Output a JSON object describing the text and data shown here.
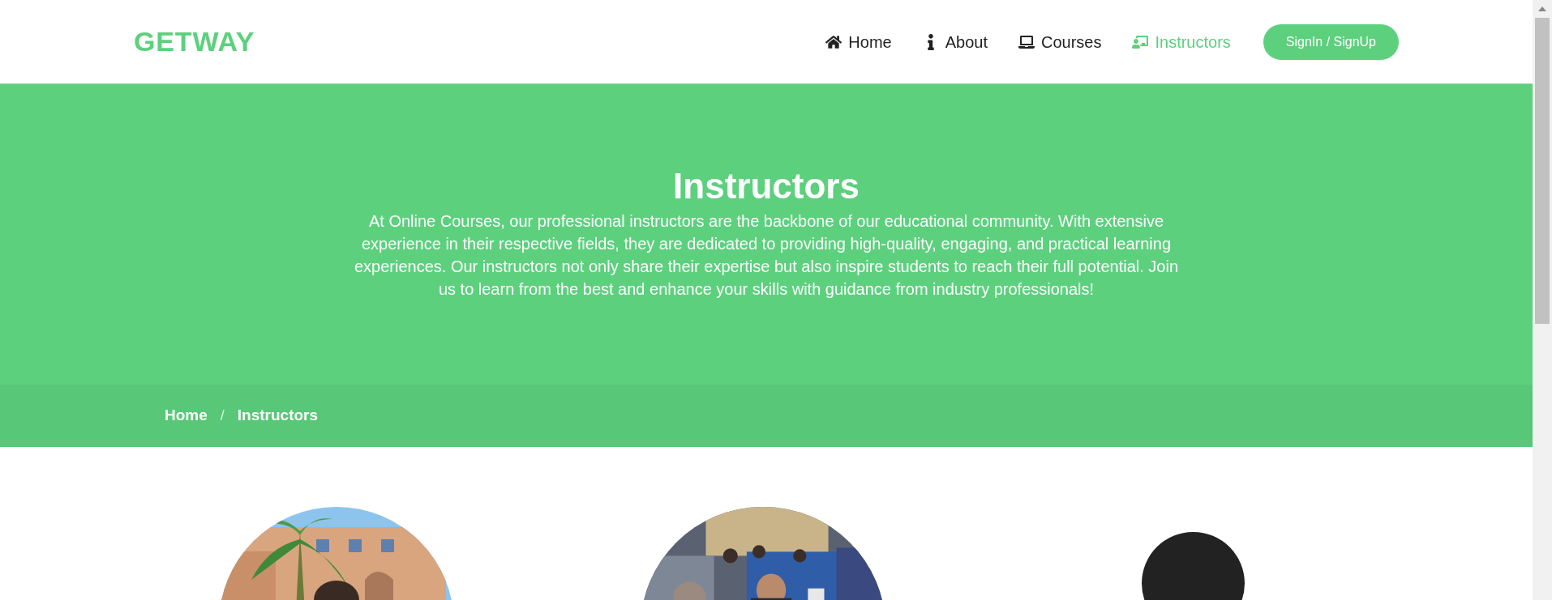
{
  "logo": "GETWAY",
  "nav": [
    {
      "label": "Home",
      "selected": false
    },
    {
      "label": "About",
      "selected": false
    },
    {
      "label": "Courses",
      "selected": false
    },
    {
      "label": "Instructors",
      "selected": true
    }
  ],
  "signin_button": "SignIn / SignUp",
  "hero": {
    "title": "Instructors",
    "text": "At Online Courses, our professional instructors are the backbone of our educational community. With extensive experience in their respective fields, they are dedicated to providing high-quality, engaging, and practical learning experiences. Our instructors not only share their expertise but also inspire students to reach their full potential. Join us to learn from the best and enhance your skills with guidance from industry professionals!"
  },
  "breadcrumb": [
    {
      "label": "Home"
    },
    {
      "label": "Instructors"
    }
  ],
  "breadcrumb_separator": "/",
  "instructors": [
    {
      "kind": "picture"
    },
    {
      "kind": "picture"
    },
    {
      "kind": "avatar"
    }
  ]
}
